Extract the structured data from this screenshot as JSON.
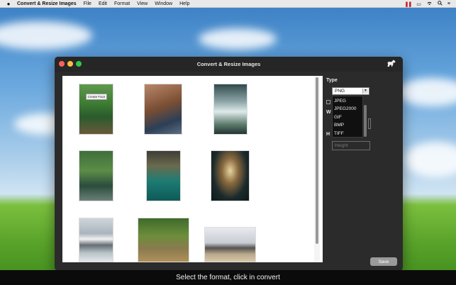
{
  "menubar": {
    "apple_icon": "apple-icon",
    "app_name": "Convert & Resize Images",
    "menus": [
      "File",
      "Edit",
      "Format",
      "View",
      "Window",
      "Help"
    ],
    "status_icons": [
      "pause-bars-icon",
      "display-icon",
      "wifi-icon",
      "search-icon",
      "list-icon"
    ]
  },
  "window": {
    "title": "Convert & Resize Images",
    "logo_icon": "horse-logo-icon",
    "first_thumb_overlay": "Create Face"
  },
  "panel": {
    "type_label": "Type",
    "selected_format": "PNG",
    "format_options": [
      "JPEG",
      "JPEG2000",
      "GIF",
      "BMP",
      "TIFF"
    ],
    "width_label_fragment": "W",
    "height_label_fragment": "H",
    "height_placeholder": "Height",
    "save_label": "Save"
  },
  "caption": "Select the format, click in convert",
  "colors": {
    "window_bg": "#2b2b2b",
    "titlebar": "#262626",
    "close": "#fc605c",
    "minimize": "#fdbc40",
    "maximize": "#34c84a",
    "status_red": "#d0202a"
  }
}
